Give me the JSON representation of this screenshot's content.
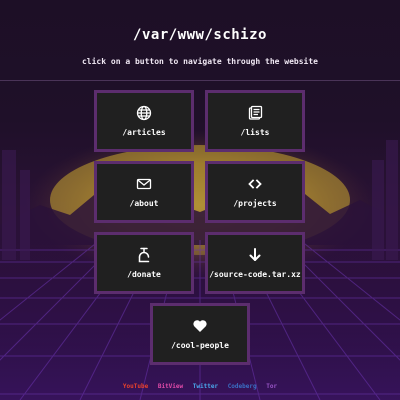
{
  "header": {
    "title": "/var/www/schizo",
    "subtitle": "click on a button to navigate through the website"
  },
  "nav": {
    "articles": {
      "label": "/articles",
      "icon": "globe-icon"
    },
    "lists": {
      "label": "/lists",
      "icon": "notes-icon"
    },
    "about": {
      "label": "/about",
      "icon": "envelope-icon"
    },
    "projects": {
      "label": "/projects",
      "icon": "code-brackets-icon"
    },
    "donate": {
      "label": "/donate",
      "icon": "monero-icon"
    },
    "source": {
      "label": "/source-code.tar.xz",
      "icon": "download-arrow-icon"
    },
    "cool": {
      "label": "/cool-people",
      "icon": "heart-icon"
    }
  },
  "footer": {
    "links": [
      {
        "label": "YouTube",
        "color": "#e8412c"
      },
      {
        "label": "BitView",
        "color": "#e04aa8"
      },
      {
        "label": "Twitter",
        "color": "#4aa6ea"
      },
      {
        "label": "Codeberg",
        "color": "#3a6fc4"
      },
      {
        "label": "Tor",
        "color": "#9a55c8"
      }
    ]
  },
  "theme": {
    "button_border": "#5c2d6e",
    "button_bg": "#202020",
    "sun": "#d9b43a",
    "grid": "#5a2a9a"
  }
}
